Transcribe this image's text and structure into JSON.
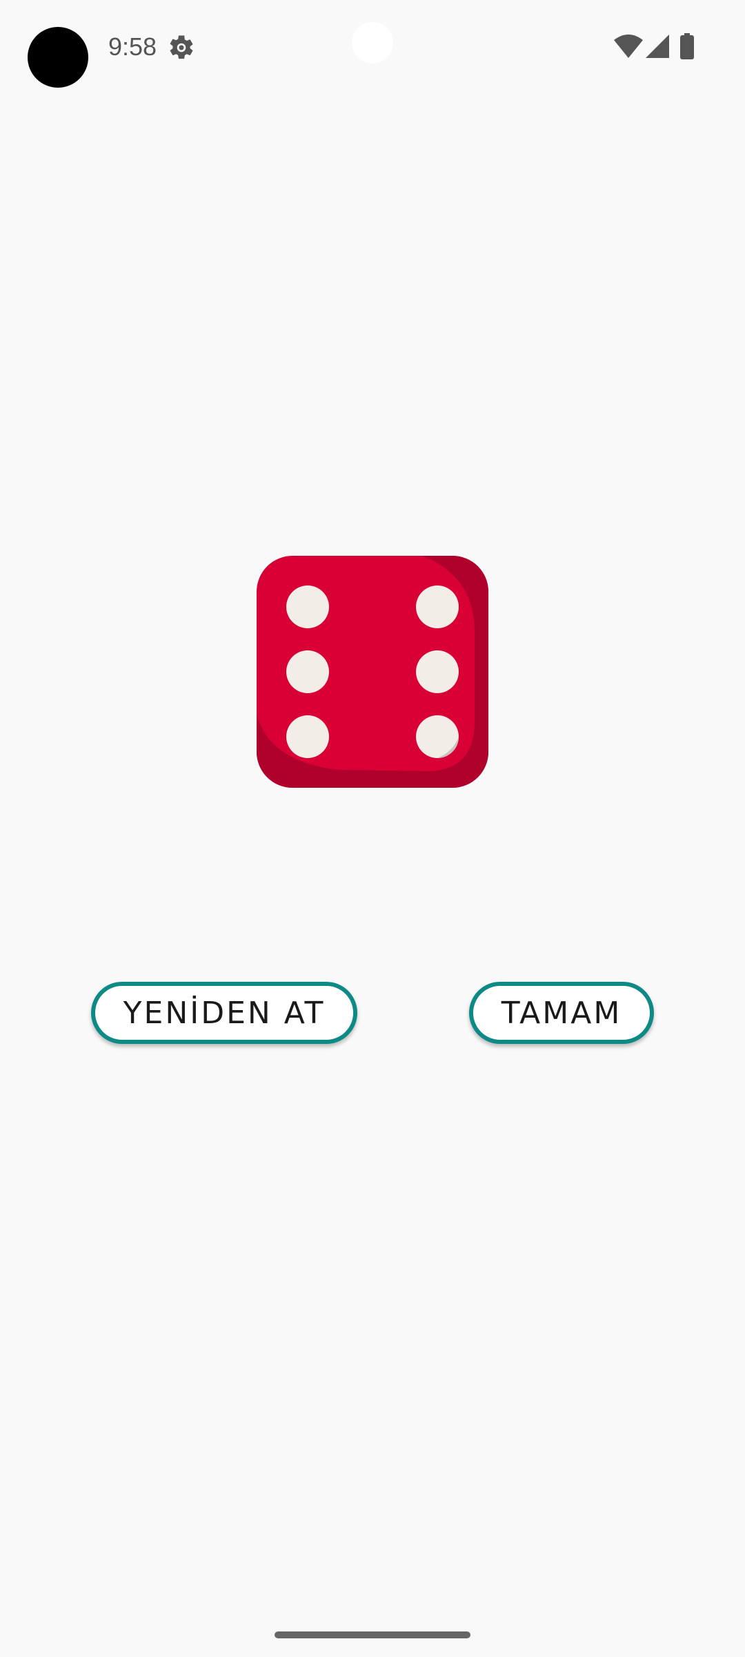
{
  "status_bar": {
    "time": "9:58",
    "icons": [
      "avatar-icon",
      "gear-icon",
      "wifi-icon",
      "signal-icon",
      "battery-icon"
    ]
  },
  "dice": {
    "face_value": 6,
    "color": "#d90036",
    "pip_color": "#f2ede6"
  },
  "buttons": {
    "reroll_label": "YENİDEN AT",
    "ok_label": "TAMAM",
    "border_color": "#0e8a86"
  }
}
